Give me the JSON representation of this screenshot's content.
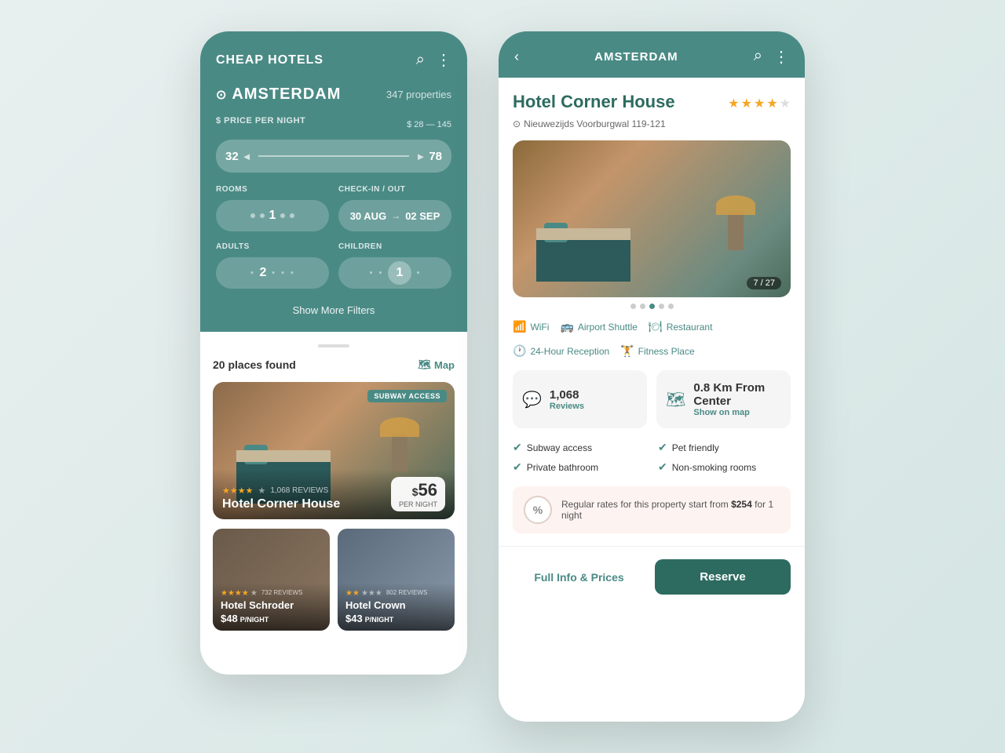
{
  "left_phone": {
    "header": {
      "title": "CHEAP HOTELS",
      "search_icon": "⌕",
      "menu_icon": "⋮"
    },
    "location": {
      "icon": "⊙",
      "name": "AMSTERDAM",
      "properties": "347 properties"
    },
    "price_filter": {
      "label": "$ PRICE PER NIGHT",
      "range_text": "$ 28 — 145",
      "min": "32",
      "max": "78"
    },
    "rooms": {
      "label": "ROOMS",
      "value": "1"
    },
    "checkin": {
      "label": "CHECK-IN / OUT",
      "checkin": "30 AUG",
      "checkout": "02 SEP"
    },
    "adults": {
      "label": "ADULTS",
      "value": "2"
    },
    "children": {
      "label": "CHILDREN",
      "value": "1"
    },
    "show_more": "Show More Filters",
    "results": {
      "count": "20",
      "label": "places found",
      "map_label": "Map"
    },
    "hotels": [
      {
        "name": "Hotel Corner House",
        "badge": "SUBWAY ACCESS",
        "stars": 4,
        "reviews": "1,068",
        "reviews_label": "REVIEWS",
        "price": "56",
        "per": "PER NIGHT"
      },
      {
        "name": "Hotel Schroder",
        "stars": 4,
        "reviews": "732",
        "reviews_label": "REVIEWS",
        "price": "48",
        "per": "P/NIGHT"
      },
      {
        "name": "Hotel Crown",
        "stars": 2,
        "reviews": "802",
        "reviews_label": "REVIEWS",
        "price": "43",
        "per": "P/NIGHT"
      }
    ]
  },
  "right_phone": {
    "header": {
      "back_icon": "‹",
      "title": "AMSTERDAM",
      "search_icon": "⌕",
      "menu_icon": "⋮"
    },
    "hotel": {
      "name": "Hotel Corner House",
      "stars": 4,
      "max_stars": 5,
      "address_icon": "⊙",
      "address": "Nieuwezijds Voorburgwal 119-121",
      "img_counter": "7 / 27"
    },
    "amenities": [
      {
        "icon": "wifi",
        "label": "WiFi"
      },
      {
        "icon": "shuttle",
        "label": "Airport Shuttle"
      },
      {
        "icon": "restaurant",
        "label": "Restaurant"
      },
      {
        "icon": "clock",
        "label": "24-Hour Reception"
      },
      {
        "icon": "fitness",
        "label": "Fitness Place"
      }
    ],
    "reviews_card": {
      "icon": "💬",
      "count": "1,068",
      "label": "Reviews"
    },
    "location_card": {
      "icon": "🗺",
      "distance": "0.8 Km From Center",
      "action": "Show on map"
    },
    "features": [
      "Subway access",
      "Pet friendly",
      "Private bathroom",
      "Non-smoking rooms"
    ],
    "rate_text": "Regular rates for this property start from ",
    "rate_price": "$254",
    "rate_suffix": " for 1 night",
    "full_info_label": "Full Info & Prices",
    "reserve_label": "Reserve"
  }
}
